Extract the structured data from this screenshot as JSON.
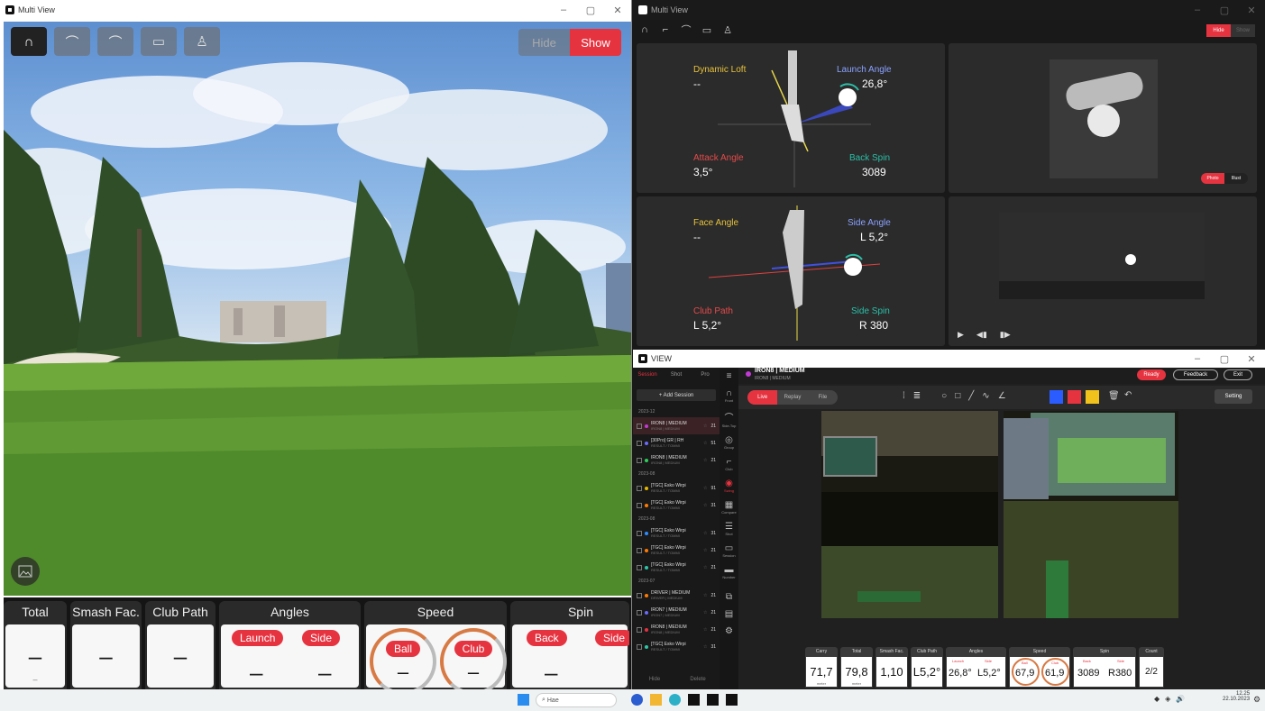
{
  "win1": {
    "title": "Multi View",
    "hide_label": "Hide",
    "show_label": "Show",
    "panels": {
      "total": {
        "label": "Total",
        "value": "–",
        "sub": "–"
      },
      "smash": {
        "label": "Smash Fac.",
        "value": "–"
      },
      "clubpath": {
        "label": "Club Path",
        "value": "–"
      },
      "angles": {
        "label": "Angles",
        "launch": "Launch",
        "side": "Side",
        "launch_value": "–",
        "side_value": "–"
      },
      "speed": {
        "label": "Speed",
        "ball": "Ball",
        "club": "Club",
        "ball_value": "–",
        "club_value": "–"
      },
      "spin": {
        "label": "Spin",
        "back": "Back",
        "side": "Side",
        "back_value": "–",
        "side_value": "–"
      }
    }
  },
  "win2": {
    "title": "Multi View",
    "hide_label": "Hide",
    "show_label": "Show",
    "dynamic_loft_label": "Dynamic Loft",
    "dynamic_loft_value": "--",
    "launch_angle_label": "Launch Angle",
    "launch_angle_value": "26,8°",
    "attack_angle_label": "Attack Angle",
    "attack_angle_value": "3,5°",
    "back_spin_label": "Back Spin",
    "back_spin_value": "3089",
    "face_angle_label": "Face Angle",
    "face_angle_value": "--",
    "side_angle_label": "Side Angle",
    "side_angle_value": "L 5,2°",
    "club_path_label": "Club Path",
    "club_path_value": "L 5,2°",
    "side_spin_label": "Side Spin",
    "side_spin_value": "R 380",
    "photo_label": "Photo",
    "illust_label": "Illust"
  },
  "win3": {
    "title": "VIEW",
    "tabs": [
      "Session",
      "Shot",
      "Pro"
    ],
    "add_session": "+ Add Session",
    "groups": [
      {
        "date": "2023-12",
        "rows": [
          {
            "name": "IRON8 | MEDIUM",
            "sub": "IRON8 | MEDIUM",
            "n": "21",
            "color": "#c23ad6",
            "sel": true
          },
          {
            "name": "[30Pro] GR | RH",
            "sub": "RESULT / TOMMI",
            "n": "51",
            "color": "#6a6aff",
            "sel": false
          },
          {
            "name": "IRON8 | MEDIUM",
            "sub": "IRON8 | MEDIUM",
            "n": "21",
            "color": "#2ccf5a",
            "sel": false
          }
        ]
      },
      {
        "date": "2023-08",
        "rows": [
          {
            "name": "[TGC] Esko Wirpi",
            "sub": "RESULT / TOMMI",
            "n": "91",
            "color": "#e6b800",
            "sel": false
          },
          {
            "name": "[TGC] Esko Wirpi",
            "sub": "RESULT / TOMMI",
            "n": "31",
            "color": "#ff7a00",
            "sel": false
          }
        ]
      },
      {
        "date": "2023-08",
        "rows": [
          {
            "name": "[TGC] Esko Wirpi",
            "sub": "RESULT / TOMMI",
            "n": "31",
            "color": "#2c8cff",
            "sel": false
          },
          {
            "name": "[TGC] Esko Wirpi",
            "sub": "RESULT / TOMMI",
            "n": "21",
            "color": "#ff7a00",
            "sel": false
          },
          {
            "name": "[TGC] Esko Wirpi",
            "sub": "RESULT / TOMMI",
            "n": "21",
            "color": "#2cc7a8",
            "sel": false
          }
        ]
      },
      {
        "date": "2023-07",
        "rows": [
          {
            "name": "DRIVER | MEDIUM",
            "sub": "DRIVER | MEDIUM",
            "n": "21",
            "color": "#ff7a00",
            "sel": false
          },
          {
            "name": "IRON7 | MEDIUM",
            "sub": "IRON7 | MEDIUM",
            "n": "21",
            "color": "#6a6aff",
            "sel": false
          },
          {
            "name": "IRON8 | MEDIUM",
            "sub": "IRON8 | MEDIUM",
            "n": "21",
            "color": "#e63340",
            "sel": false
          },
          {
            "name": "[TGC] Esko Wirpi",
            "sub": "RESULT / TOMMI",
            "n": "31",
            "color": "#2cc7a8",
            "sel": false
          }
        ]
      }
    ],
    "hide": "Hide",
    "delete": "Delete",
    "icons": [
      "Front",
      "Side-Top",
      "Group",
      "Club",
      "Swing",
      "Compare",
      "Shot",
      "Session",
      "Number"
    ],
    "session_title": "IRON8 | MEDIUM",
    "session_sub": "IRON8 | MEDIUM",
    "ready": "Ready",
    "feedback": "Feedback",
    "exit": "Exit",
    "live": "Live",
    "replay": "Replay",
    "file": "File",
    "setting": "Setting",
    "metrics": {
      "carry": {
        "label": "Carry",
        "value": "71,7",
        "unit": "meter"
      },
      "total": {
        "label": "Total",
        "value": "79,8",
        "unit": "meter"
      },
      "smash": {
        "label": "Smash Fac.",
        "value": "1,10"
      },
      "clubpath": {
        "label": "Club Path",
        "value": "L5,2°"
      },
      "angles": {
        "label": "Angles",
        "launch": "Launch",
        "side": "Side",
        "launch_value": "26,8°",
        "side_value": "L5,2°"
      },
      "speed": {
        "label": "Speed",
        "ball": "Ball",
        "club": "Club",
        "ball_value": "67,9",
        "club_value": "61,9"
      },
      "spin": {
        "label": "Spin",
        "back": "Back",
        "side": "Side",
        "back_value": "3089",
        "side_value": "R380"
      },
      "count": {
        "label": "Count",
        "value": "2/2"
      }
    }
  },
  "taskbar": {
    "search": "Hae",
    "time": "12.25",
    "date": "22.10.2023"
  }
}
